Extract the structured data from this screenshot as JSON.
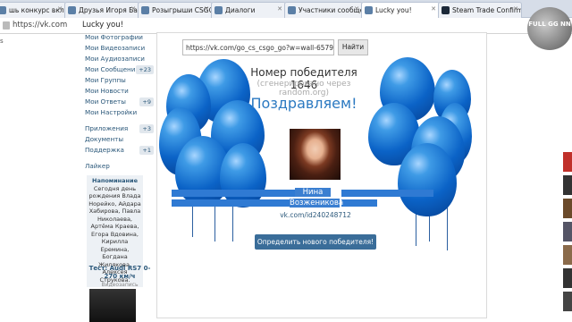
{
  "browser": {
    "tabs": [
      {
        "label": "шь конкурс вкл",
        "fav": "vk"
      },
      {
        "label": "Друзья Игоря Бабич",
        "fav": "vk"
      },
      {
        "label": "Розыгрыши CSGO | ",
        "fav": "vk"
      },
      {
        "label": "Диалоги",
        "fav": "vk"
      },
      {
        "label": "Участники сообщест",
        "fav": "vk"
      },
      {
        "label": "Lucky you!",
        "fav": "vk"
      },
      {
        "label": "Steam Trade Confirm",
        "fav": "steam"
      }
    ],
    "url": "https://vk.com",
    "page_title": "Lucky you!",
    "corner_logo": "FULL GG NN"
  },
  "left_fragment": "s",
  "sidebar": {
    "items": [
      {
        "label": "Мои Фотографии",
        "badge": ""
      },
      {
        "label": "Мои Видеозаписи",
        "badge": ""
      },
      {
        "label": "Мои Аудиозаписи",
        "badge": ""
      },
      {
        "label": "Мои Сообщения",
        "badge": "+23"
      },
      {
        "label": "Мои Группы",
        "badge": ""
      },
      {
        "label": "Мои Новости",
        "badge": ""
      },
      {
        "label": "Мои Ответы",
        "badge": "+9"
      },
      {
        "label": "Мои Настройки",
        "badge": ""
      }
    ],
    "items2": [
      {
        "label": "Приложения",
        "badge": "+3"
      },
      {
        "label": "Документы",
        "badge": ""
      },
      {
        "label": "Поддержка",
        "badge": "+1"
      }
    ],
    "likes": "Лайкер"
  },
  "reminder": {
    "heading": "Напоминание",
    "text": "Сегодня день рождения Влада Норейко, Айдара Хабирова, Павла Николаева, Артёма Краева, Егора Вдовина, Кирилла Еремина, Богдана Жилякова, Алексея Струкова."
  },
  "ad": {
    "title": "Тест: Audi RS7 0-270 км/ч",
    "sub": "Видеозапись"
  },
  "main": {
    "post_url": "https://vk.com/go_cs_csgo_go?w=wall-657906",
    "find_button": "Найти",
    "winner_number": "Номер победителя 1646",
    "generated": "(сгенерировано через random.org)",
    "congrats": "Поздравляем!",
    "winner_first": "Нина",
    "winner_last": "Возженикова",
    "winner_link": "vk.com/id240248712",
    "new_winner_button": "Определить нового победителя!"
  }
}
